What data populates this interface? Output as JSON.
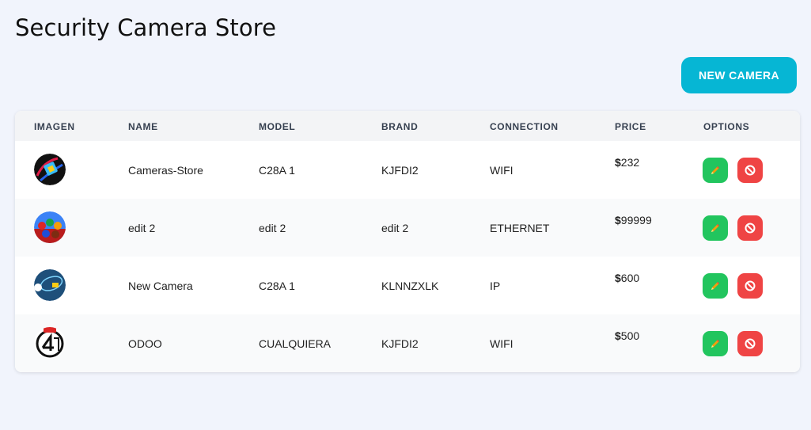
{
  "page": {
    "title": "Security Camera Store",
    "new_button_label": "NEW CAMERA"
  },
  "colors": {
    "background": "#f1f4fc",
    "accent": "#06b6d4",
    "edit": "#22c55e",
    "delete": "#ef4444"
  },
  "table": {
    "columns": [
      "IMAGEN",
      "NAME",
      "MODEL",
      "BRAND",
      "CONNECTION",
      "PRICE",
      "OPTIONS"
    ],
    "rows": [
      {
        "image": "camera-logo-avatar",
        "name": "Cameras-Store",
        "model": "C28A 1",
        "brand": "KJFDI2",
        "connection": "WIFI",
        "currency": "$",
        "price": "232"
      },
      {
        "image": "crowd-photo-avatar",
        "name": "edit 2",
        "model": "edit 2",
        "brand": "edit 2",
        "connection": "ETHERNET",
        "currency": "$",
        "price": "99999"
      },
      {
        "image": "planet-logo-avatar",
        "name": "New Camera",
        "model": "C28A 1",
        "brand": "KLNNZXLK",
        "connection": "IP",
        "currency": "$",
        "price": "600"
      },
      {
        "image": "marvel-logo-avatar",
        "name": "ODOO",
        "model": "CUALQUIERA",
        "brand": "KJFDI2",
        "connection": "WIFI",
        "currency": "$",
        "price": "500"
      }
    ],
    "options_icons": [
      "pencil-icon",
      "ban-icon"
    ]
  }
}
